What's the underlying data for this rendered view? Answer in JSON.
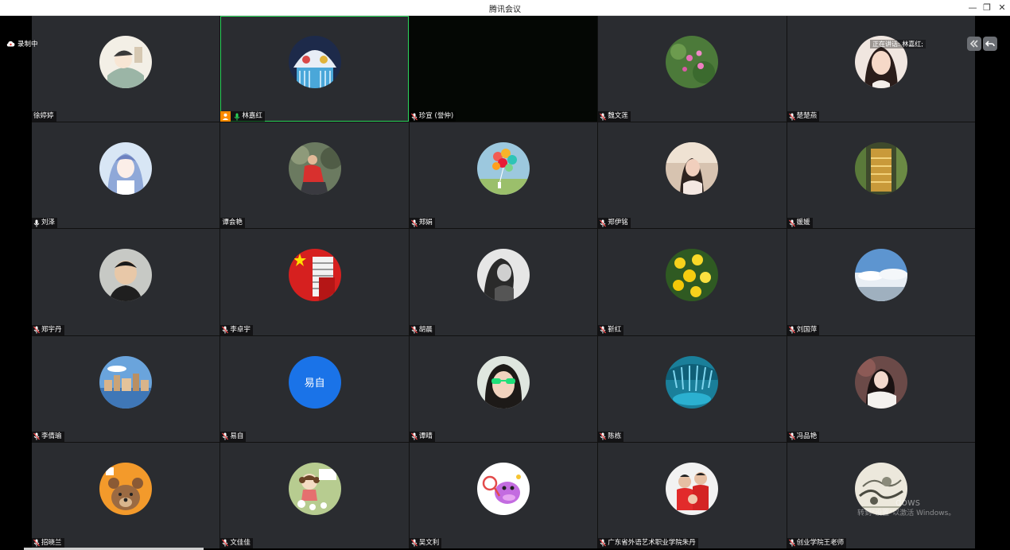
{
  "window": {
    "title": "腾讯会议",
    "minimize": "—",
    "restore": "❐",
    "close": "✕"
  },
  "recording": {
    "label": "录制中",
    "icon": "cloud-recording-icon"
  },
  "speaking": {
    "label": "正在讲话: 林嘉红;"
  },
  "right_tools": [
    {
      "icon": "double-chevron-icon"
    },
    {
      "icon": "undo-arrow-icon"
    }
  ],
  "watermark": {
    "line1": "dows",
    "line2": "转到\"设置\"以激活 Windows。"
  },
  "colors": {
    "active_speaker": "#2bd35a",
    "host_badge": "#ff8a00",
    "tile_bg": "#2a2c30",
    "text_avatar": "#1a73e8"
  },
  "participants": [
    {
      "name": "徐婷婷",
      "mic": "none",
      "avatar": "comic"
    },
    {
      "name": "林嘉红",
      "mic": "speaking",
      "host": true,
      "active": true,
      "avatar": "lion-dance"
    },
    {
      "name": "珍宣 (誉仲)",
      "mic": "muted",
      "video_off": true,
      "avatar": "none"
    },
    {
      "name": "魏文莲",
      "mic": "muted",
      "avatar": "flowers-pink"
    },
    {
      "name": "楚楚燕",
      "mic": "muted",
      "avatar": "girl-portrait"
    },
    {
      "name": "刘泽",
      "mic": "on",
      "avatar": "anime-girl"
    },
    {
      "name": "谭会艳",
      "mic": "none",
      "avatar": "outdoor-woman"
    },
    {
      "name": "郑娟",
      "mic": "muted",
      "avatar": "balloons"
    },
    {
      "name": "郑伊铭",
      "mic": "muted",
      "avatar": "woman-room"
    },
    {
      "name": "媛媛",
      "mic": "muted",
      "avatar": "golden-stairs"
    },
    {
      "name": "郑宇丹",
      "mic": "muted",
      "avatar": "boy"
    },
    {
      "name": "李卓宇",
      "mic": "muted",
      "avatar": "china-flag"
    },
    {
      "name": "胡晨",
      "mic": "muted",
      "avatar": "bw-woman"
    },
    {
      "name": "靳红",
      "mic": "muted",
      "avatar": "yellow-flowers"
    },
    {
      "name": "刘国萍",
      "mic": "muted",
      "avatar": "clouds"
    },
    {
      "name": "李倩瑜",
      "mic": "muted",
      "avatar": "city"
    },
    {
      "name": "易自",
      "mic": "muted",
      "avatar": "text",
      "avatar_text": "易自"
    },
    {
      "name": "谭晴",
      "mic": "muted",
      "avatar": "sunglasses-girl"
    },
    {
      "name": "陈栋",
      "mic": "muted",
      "avatar": "pool"
    },
    {
      "name": "冯品艳",
      "mic": "muted",
      "avatar": "woman-dark"
    },
    {
      "name": "招晓兰",
      "mic": "muted",
      "avatar": "bear"
    },
    {
      "name": "文佳佳",
      "mic": "muted",
      "avatar": "cartoon-girl"
    },
    {
      "name": "吴文利",
      "mic": "muted",
      "avatar": "purple-hippo"
    },
    {
      "name": "广东省外语艺术职业学院朱丹",
      "mic": "muted",
      "avatar": "family"
    },
    {
      "name": "创业学院王老师",
      "mic": "muted",
      "avatar": "ink-painting"
    }
  ]
}
